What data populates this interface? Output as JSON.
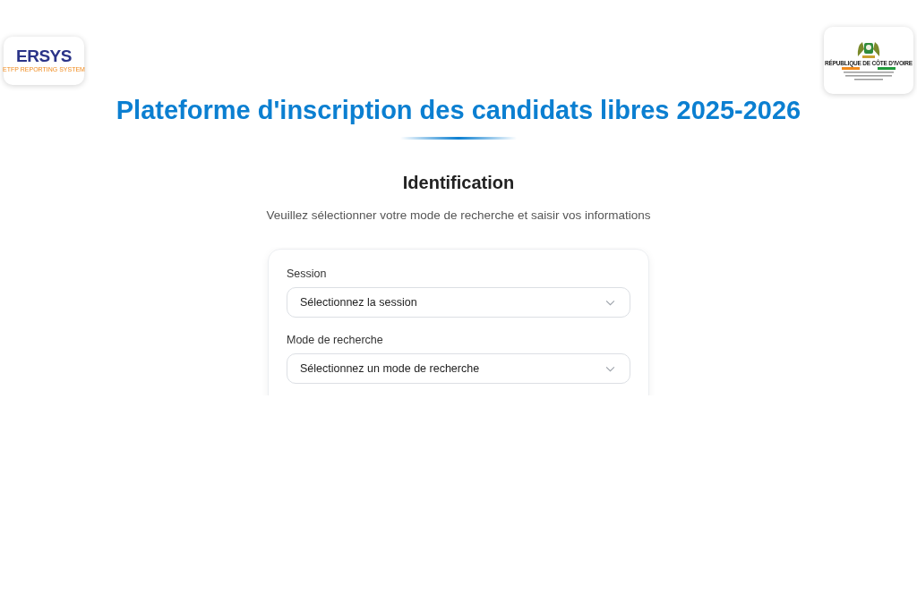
{
  "header": {
    "left_logo": {
      "wordmark": "ERSYS",
      "tagline": "ETFP REPORTING SYSTEM"
    },
    "right_logo": {
      "caption": "RÉPUBLIQUE DE CÔTE D'IVOIRE"
    }
  },
  "title": "Plateforme d'inscription des candidats libres 2025-2026",
  "section": {
    "heading": "Identification",
    "subtitle": "Veuillez sélectionner votre mode de recherche et saisir vos informations"
  },
  "form": {
    "fields": [
      {
        "label": "Session",
        "placeholder": "Sélectionnez la session"
      },
      {
        "label": "Mode de recherche",
        "placeholder": "Sélectionnez un mode de recherche"
      }
    ]
  }
}
